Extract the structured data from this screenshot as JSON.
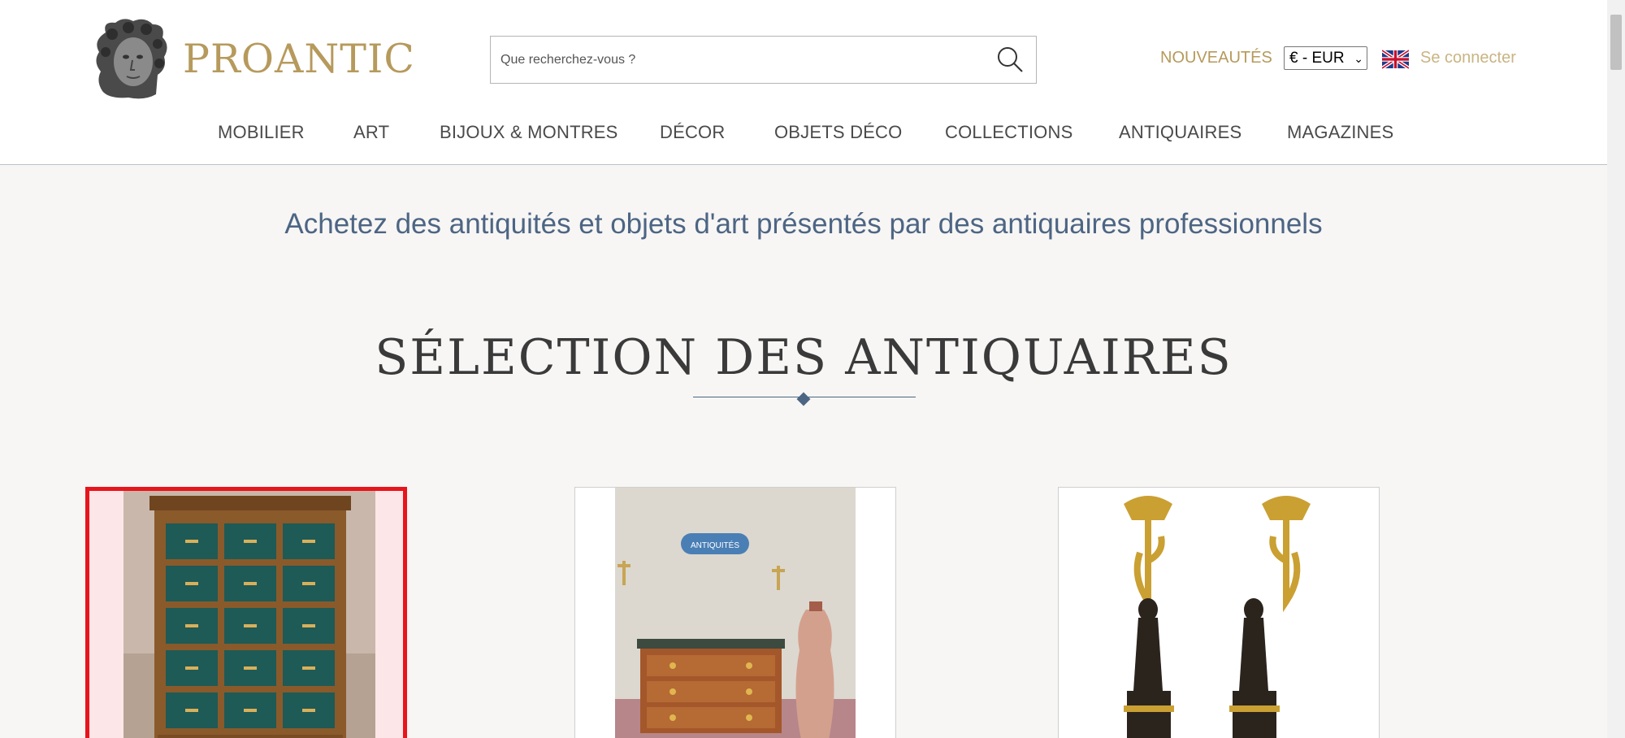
{
  "header": {
    "brand": "PROANTIC",
    "search_placeholder": "Que recherchez-vous ?",
    "nouveautes": "NOUVEAUTÉS",
    "currency": "€ - EUR",
    "language_icon": "uk-flag-icon",
    "login": "Se connecter"
  },
  "nav": {
    "items": [
      "MOBILIER",
      "ART",
      "BIJOUX & MONTRES",
      "DÉCOR",
      "OBJETS DÉCO",
      "COLLECTIONS",
      "ANTIQUAIRES",
      "MAGAZINES"
    ]
  },
  "main": {
    "tagline": "Achetez des antiquités et objets d'art présentés par des antiquaires professionnels",
    "section_title": "SÉLECTION DES ANTIQUAIRES"
  },
  "colors": {
    "gold": "#b69a5c",
    "blue": "#4d6584",
    "selection": "#e8141c"
  }
}
